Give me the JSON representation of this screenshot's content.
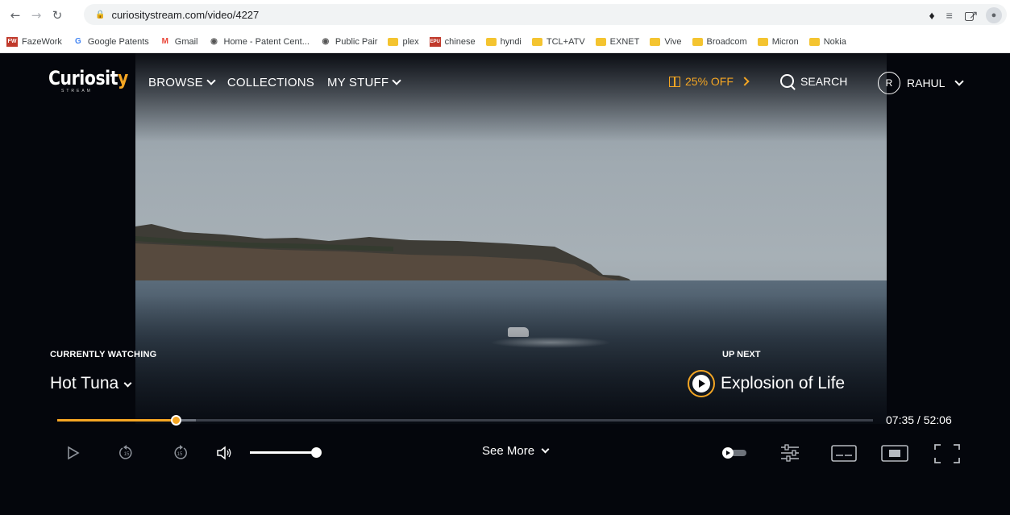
{
  "browser": {
    "url": "curiositystream.com/video/4227",
    "bookmarks": [
      {
        "label": "FazeWork",
        "icon": "fazework-icon",
        "color": "#c0392b"
      },
      {
        "label": "Google Patents",
        "icon": "google-icon",
        "color": "#4285f4"
      },
      {
        "label": "Gmail",
        "icon": "gmail-icon",
        "color": "#ea4335"
      },
      {
        "label": "Home - Patent Cent...",
        "icon": "location-pin-icon",
        "color": "#555555"
      },
      {
        "label": "Public Pair",
        "icon": "location-pin-icon",
        "color": "#555555"
      },
      {
        "label": "plex",
        "icon": "folder-icon",
        "color": "#f4c430"
      },
      {
        "label": "chinese",
        "icon": "epu-icon",
        "color": "#c0392b"
      },
      {
        "label": "hyndi",
        "icon": "folder-icon",
        "color": "#f4c430"
      },
      {
        "label": "TCL+ATV",
        "icon": "folder-icon",
        "color": "#f4c430"
      },
      {
        "label": "EXNET",
        "icon": "folder-icon",
        "color": "#f4c430"
      },
      {
        "label": "Vive",
        "icon": "folder-icon",
        "color": "#f4c430"
      },
      {
        "label": "Broadcom",
        "icon": "folder-icon",
        "color": "#f4c430"
      },
      {
        "label": "Micron",
        "icon": "folder-icon",
        "color": "#f4c430"
      },
      {
        "label": "Nokia",
        "icon": "folder-icon",
        "color": "#f4c430"
      }
    ]
  },
  "header": {
    "logo_main": "Curiosit",
    "logo_y": "y",
    "logo_sub": "STREAM",
    "nav": [
      {
        "label": "BROWSE",
        "has_chevron": true
      },
      {
        "label": "COLLECTIONS",
        "has_chevron": false
      },
      {
        "label": "MY STUFF",
        "has_chevron": true
      }
    ],
    "promo": "25% OFF",
    "search": "SEARCH",
    "avatar_initial": "R",
    "user_name": "RAHUL"
  },
  "player": {
    "current_label": "CURRENTLY WATCHING",
    "current_title": "Hot Tuna",
    "next_label": "UP NEXT",
    "next_title": "Explosion of Life",
    "time": "07:35 / 52:06",
    "progress_fraction": 0.145,
    "buffer_fraction": 0.17,
    "volume_fraction": 1.0,
    "see_more": "See More",
    "accent_color": "#f5a623"
  }
}
